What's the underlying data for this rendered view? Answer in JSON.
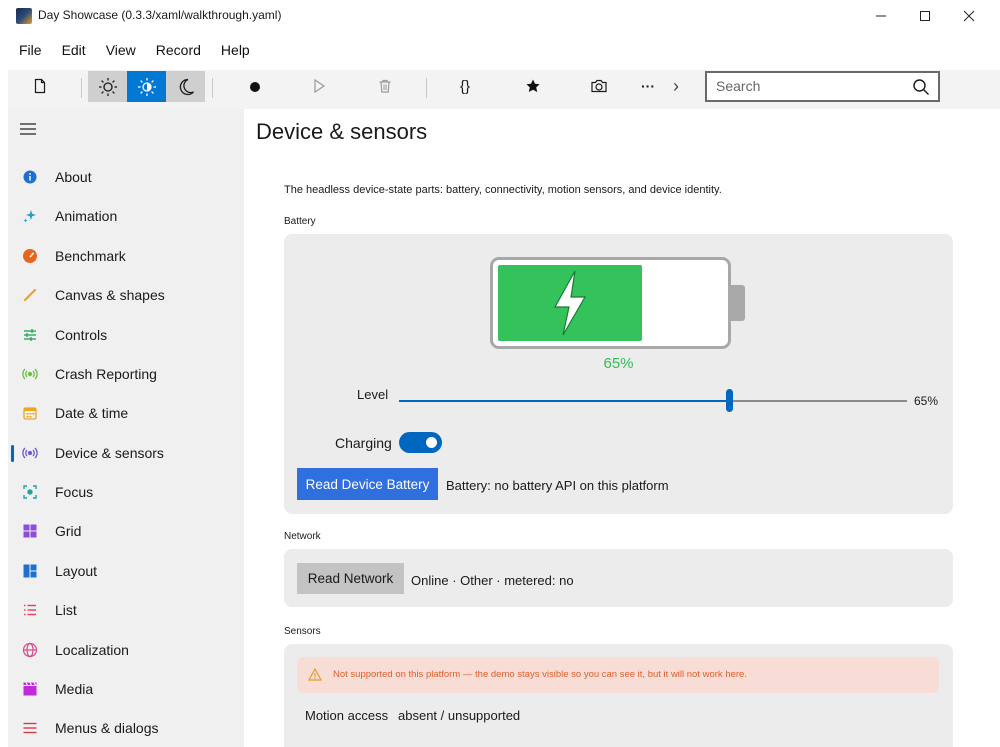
{
  "window": {
    "title": "Day Showcase (0.3.3/xaml/walkthrough.yaml)",
    "minimize": "—",
    "maximize": "☐",
    "close": "✕"
  },
  "menu": [
    "File",
    "Edit",
    "View",
    "Record",
    "Help"
  ],
  "toolbar": {
    "theme_active": "auto-contrast",
    "search_placeholder": "Search",
    "braces": "{}",
    "more": "···",
    "chevron": "›"
  },
  "sidebar": {
    "items": [
      {
        "label": "About",
        "icon": "info-icon",
        "color": "#1f6fd1"
      },
      {
        "label": "Animation",
        "icon": "sparkle-icon",
        "color": "#1fa3c4"
      },
      {
        "label": "Benchmark",
        "icon": "gauge-icon",
        "color": "#e8651f"
      },
      {
        "label": "Canvas & shapes",
        "icon": "brush-icon",
        "color": "#f0a020"
      },
      {
        "label": "Controls",
        "icon": "sliders-icon",
        "color": "#2ea85a"
      },
      {
        "label": "Crash Reporting",
        "icon": "broadcast-icon",
        "color": "#6abf3a"
      },
      {
        "label": "Date & time",
        "icon": "calendar-icon",
        "color": "#e8a81f"
      },
      {
        "label": "Device & sensors",
        "icon": "sensor-icon",
        "color": "#6a5acd",
        "selected": true
      },
      {
        "label": "Focus",
        "icon": "focus-icon",
        "color": "#1fa3a3"
      },
      {
        "label": "Grid",
        "icon": "grid-icon",
        "color": "#8a4ed8"
      },
      {
        "label": "Layout",
        "icon": "layout-icon",
        "color": "#1f6fd1"
      },
      {
        "label": "List",
        "icon": "list-icon",
        "color": "#e0405a"
      },
      {
        "label": "Localization",
        "icon": "globe-icon",
        "color": "#d84a8a"
      },
      {
        "label": "Media",
        "icon": "clapper-icon",
        "color": "#c02ad8"
      },
      {
        "label": "Menus & dialogs",
        "icon": "menu-icon",
        "color": "#d83a4a"
      }
    ]
  },
  "page": {
    "title": "Device & sensors",
    "description": "The headless device-state parts: battery, connectivity, motion sensors, and device identity.",
    "battery": {
      "section": "Battery",
      "level_percent": 65,
      "percent_text": "65%",
      "level_label": "Level",
      "slider_value_text": "65%",
      "charging_label": "Charging",
      "charging": true,
      "read_button": "Read Device Battery",
      "status": "Battery: no battery API on this platform",
      "fill_color": "#33c35a"
    },
    "network": {
      "section": "Network",
      "read_button": "Read Network",
      "status": "Online · Other · metered: no"
    },
    "sensors": {
      "section": "Sensors",
      "warning": "Not supported on this platform — the demo stays visible so you can see it, but it will not work here.",
      "motion_label": "Motion access",
      "motion_value": "absent / unsupported"
    }
  }
}
